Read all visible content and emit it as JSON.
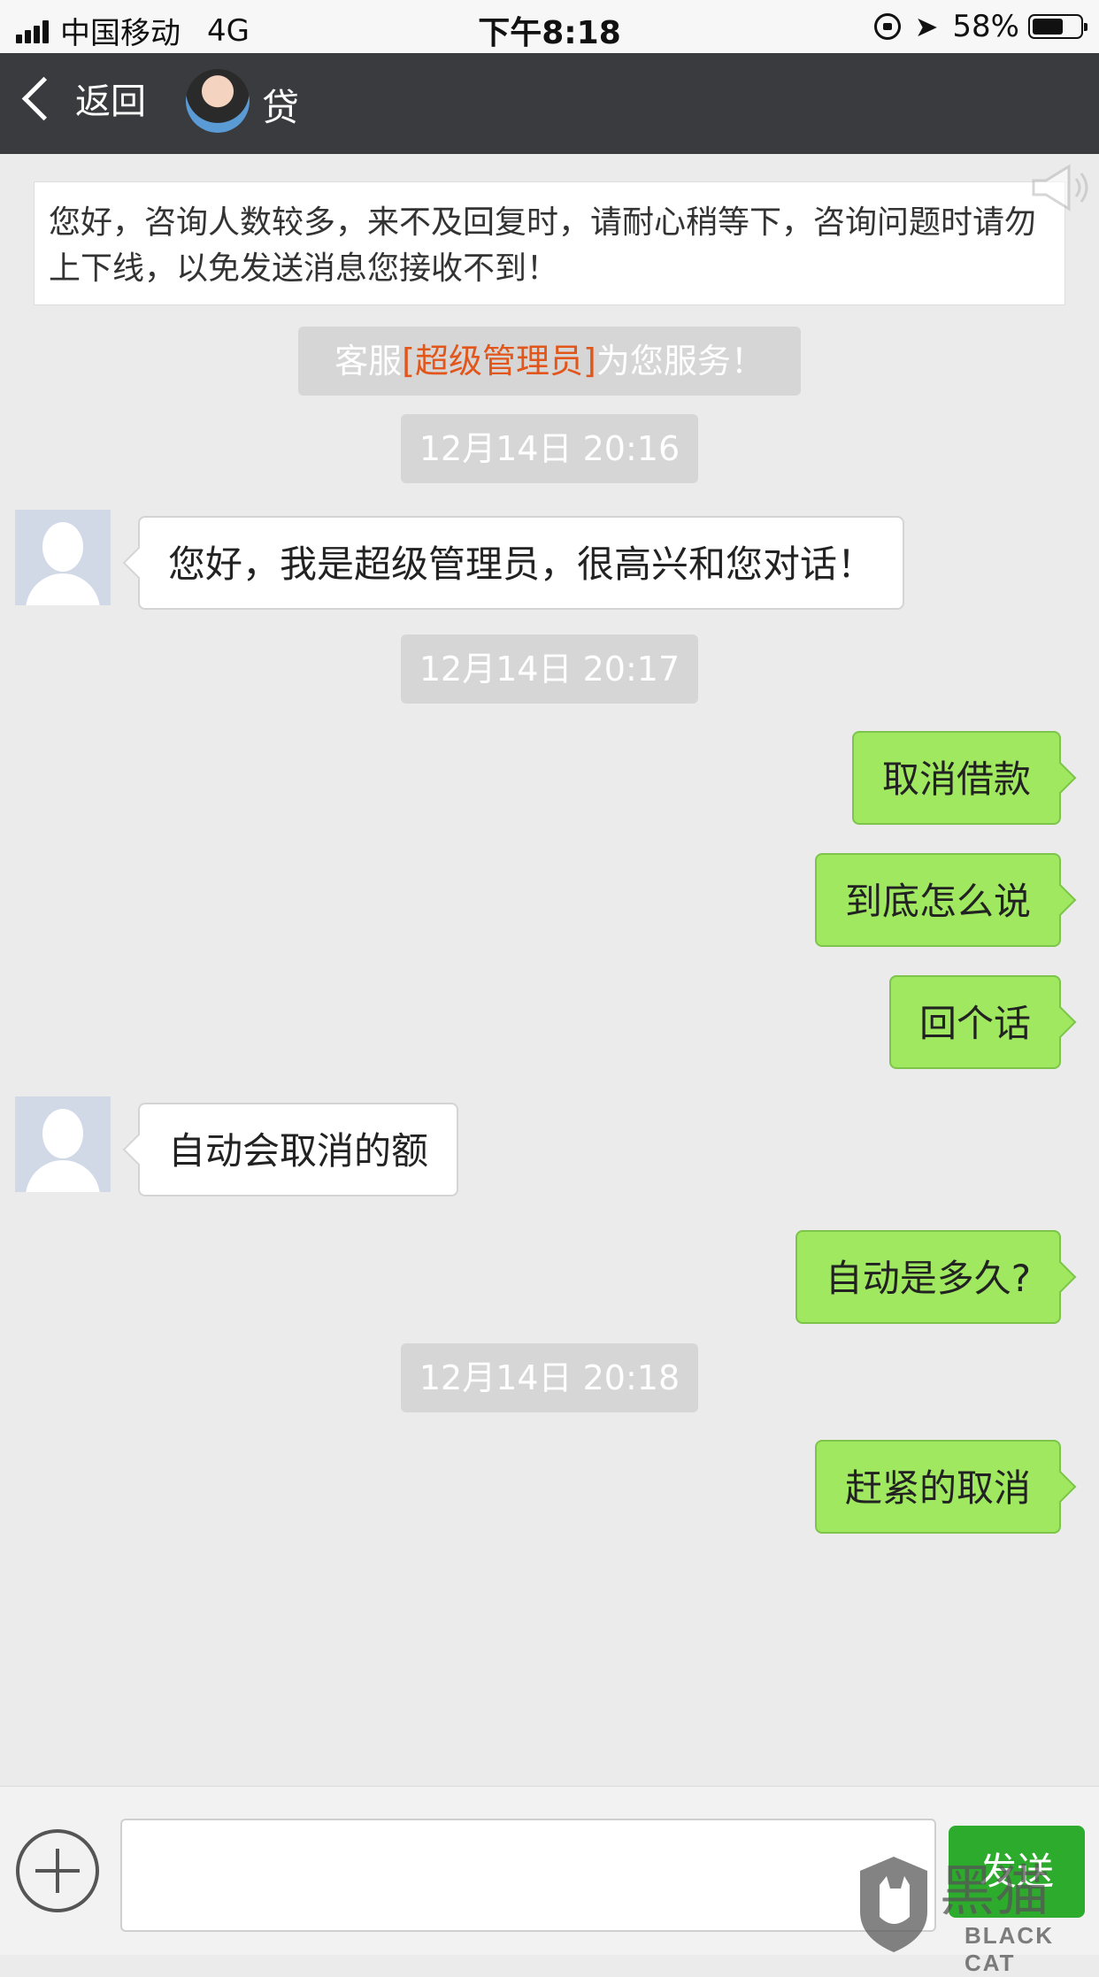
{
  "status_bar": {
    "carrier": "中国移动",
    "network": "4G",
    "time": "下午8:18",
    "battery": "58%"
  },
  "nav": {
    "back_label": "返回",
    "title": "贷"
  },
  "notice": "您好，咨询人数较多，来不及回复时，请耐心稍等下，咨询问题时请勿上下线，以免发送消息您接收不到！",
  "service": {
    "prefix": "客服",
    "agent": "[超级管理员]",
    "suffix": "为您服务！"
  },
  "timestamps": [
    "12月14日 20:16",
    "12月14日 20:17",
    "12月14日 20:18"
  ],
  "messages": [
    {
      "side": "in",
      "text": "您好，我是超级管理员，很高兴和您对话！"
    },
    {
      "side": "out",
      "text": "取消借款"
    },
    {
      "side": "out",
      "text": "到底怎么说"
    },
    {
      "side": "out",
      "text": "回个话"
    },
    {
      "side": "in",
      "text": "自动会取消的额"
    },
    {
      "side": "out",
      "text": "自动是多久?"
    },
    {
      "side": "out",
      "text": "赶紧的取消"
    }
  ],
  "input": {
    "value": "",
    "send_label": "发送"
  },
  "watermark": {
    "text": "BLACK CAT",
    "logo_text": "黑猫"
  },
  "colors": {
    "nav_bg": "#3a3b3f",
    "bubble_out": "#9fe85f",
    "send_button": "#2dab2d",
    "agent_highlight": "#e2561b"
  }
}
